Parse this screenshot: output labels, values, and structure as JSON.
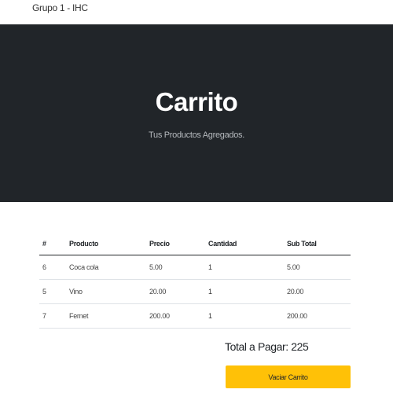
{
  "navbar": {
    "brand": "Grupo 1 - IHC"
  },
  "hero": {
    "title": "Carrito",
    "subtitle": "Tus Productos Agregados."
  },
  "table": {
    "headers": [
      "#",
      "Producto",
      "Precio",
      "Cantidad",
      "Sub Total"
    ],
    "rows": [
      {
        "id": "6",
        "product": "Coca cola",
        "price": "5.00",
        "quantity": "1",
        "subtotal": "5.00"
      },
      {
        "id": "5",
        "product": "Vino",
        "price": "20.00",
        "quantity": "1",
        "subtotal": "20.00"
      },
      {
        "id": "7",
        "product": "Fernet",
        "price": "200.00",
        "quantity": "1",
        "subtotal": "200.00"
      }
    ]
  },
  "total": {
    "label": "Total a Pagar: 225"
  },
  "buttons": {
    "view_cart": "Vaciar Carrito"
  },
  "colors": {
    "hero_bg": "#212529",
    "button_bg": "#ffc107"
  }
}
